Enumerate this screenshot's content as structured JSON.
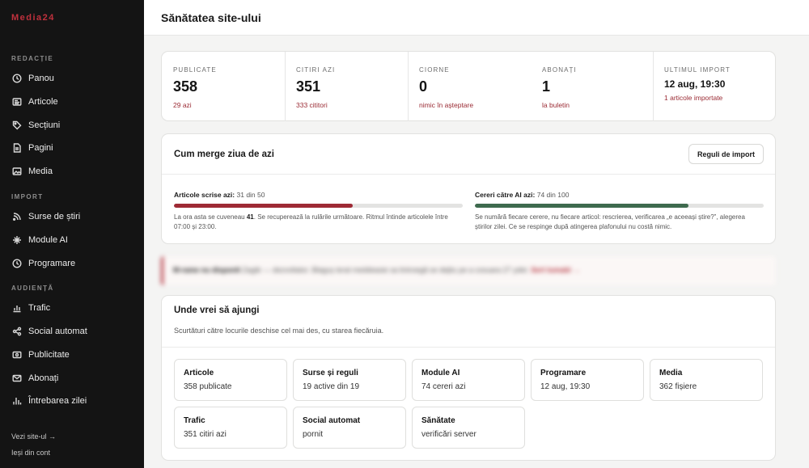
{
  "brand": "Media24",
  "sidebar": {
    "sections": [
      {
        "label": "REDACȚIE",
        "items": [
          {
            "label": "Panou",
            "icon": "clock-icon"
          },
          {
            "label": "Articole",
            "icon": "article-icon"
          },
          {
            "label": "Secțiuni",
            "icon": "tag-icon"
          },
          {
            "label": "Pagini",
            "icon": "page-icon"
          },
          {
            "label": "Media",
            "icon": "image-icon"
          }
        ]
      },
      {
        "label": "IMPORT",
        "items": [
          {
            "label": "Surse de știri",
            "icon": "rss-icon"
          },
          {
            "label": "Module AI",
            "icon": "sparkle-icon"
          },
          {
            "label": "Programare",
            "icon": "clock-icon"
          }
        ]
      },
      {
        "label": "AUDIENȚĂ",
        "items": [
          {
            "label": "Trafic",
            "icon": "chart-icon"
          },
          {
            "label": "Social automat",
            "icon": "share-icon"
          },
          {
            "label": "Publicitate",
            "icon": "ad-icon"
          },
          {
            "label": "Abonați",
            "icon": "mail-icon"
          },
          {
            "label": "Întrebarea zilei",
            "icon": "poll-icon"
          }
        ]
      }
    ],
    "footer": {
      "view_site": "Vezi site-ul →",
      "logout": "Ieși din cont"
    }
  },
  "header": {
    "title": "Sănătatea site-ului"
  },
  "stats": [
    {
      "label": "PUBLICATE",
      "value": "358",
      "sub": "29 azi"
    },
    {
      "label": "CITIRI AZI",
      "value": "351",
      "sub": "333 cititori"
    },
    {
      "label": "CIORNE",
      "value": "0",
      "sub": "nimic în așteptare"
    },
    {
      "label": "ABONAȚI",
      "value": "1",
      "sub": "la buletin"
    },
    {
      "label": "ULTIMUL IMPORT",
      "value": "12 aug, 19:30",
      "sub": "1 articole importate"
    }
  ],
  "today": {
    "title": "Cum merge ziua de azi",
    "button": "Reguli de import",
    "articles": {
      "label": "Articole scrise azi:",
      "count": "31 din 50",
      "progress": 0.62,
      "color": "#9e2a35",
      "note_a": "La ora asta se cuveneau ",
      "note_b": "41",
      "note_c": ". Se recuperează la rulările următoare. Ritmul întinde articolele între 07:00 și 23:00."
    },
    "ai": {
      "label": "Cereri către AI azi:",
      "count": "74 din 100",
      "progress": 0.74,
      "color": "#3e6a4e",
      "note": "Se numără fiecare cerere, nu fiecare articol: rescrierea, verificarea „e aceeași știre?”, alegerea știrilor zilei. Ce se respinge după atingerea plafonului nu costă nimic."
    }
  },
  "banner": {
    "strong": "M-rame nu disponit",
    "text": " Zagăr — dezvoltator. Blaguș teral meddeasie sa lintroegă se dejtiu pe a cosuara 27 ydet.",
    "link": "Sert tumabi →"
  },
  "shortcuts": {
    "title": "Unde vrei să ajungi",
    "desc": "Scurtături către locurile deschise cel mai des, cu starea fiecăruia.",
    "tiles": [
      {
        "title": "Articole",
        "sub": "358 publicate"
      },
      {
        "title": "Surse și reguli",
        "sub": "19 active din 19"
      },
      {
        "title": "Module AI",
        "sub": "74 cereri azi"
      },
      {
        "title": "Programare",
        "sub": "12 aug, 19:30"
      },
      {
        "title": "Media",
        "sub": "362 fișiere"
      },
      {
        "title": "Trafic",
        "sub": "351 citiri azi"
      },
      {
        "title": "Social automat",
        "sub": "pornit"
      },
      {
        "title": "Sănătate",
        "sub": "verificări server"
      }
    ]
  },
  "colors": {
    "accent": "#b4343f",
    "sidebar": "#141414",
    "ai_bar": "#3e6a4e"
  }
}
